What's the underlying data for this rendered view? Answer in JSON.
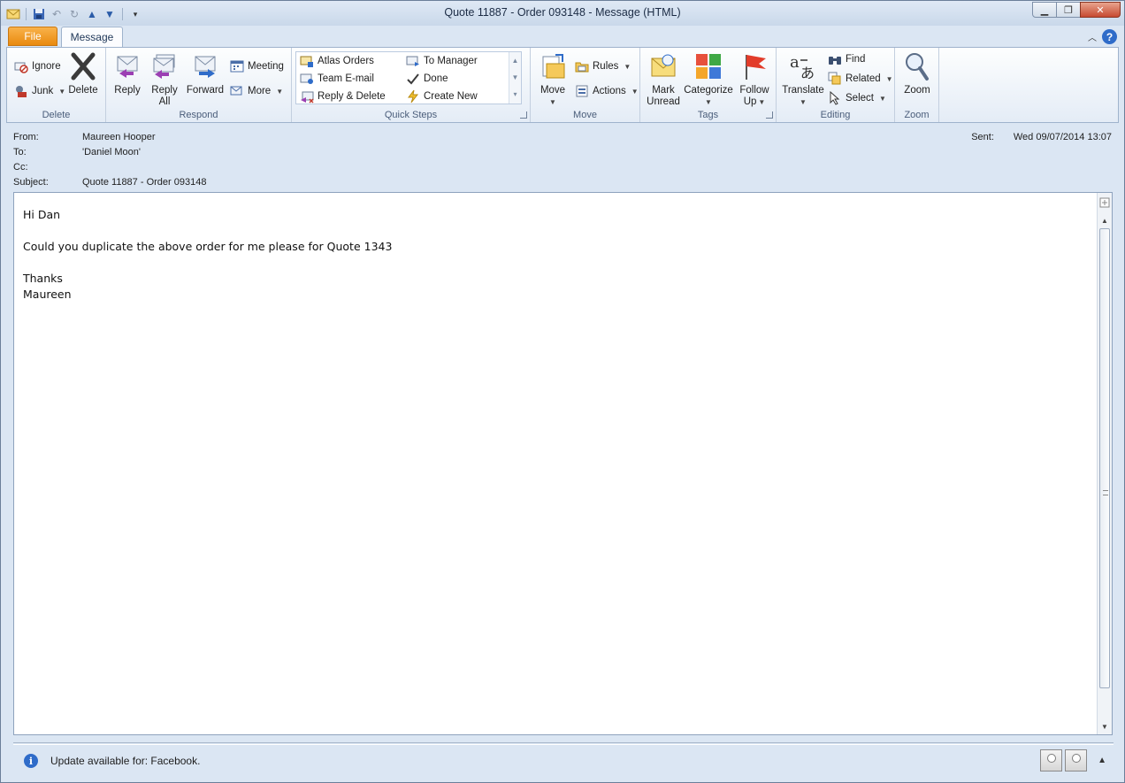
{
  "window": {
    "title": "Quote 11887 -  Order 093148  - Message (HTML)"
  },
  "tabs": {
    "file": "File",
    "message": "Message"
  },
  "ribbon": {
    "delete": {
      "label": "Delete",
      "ignore": "Ignore",
      "junk": "Junk",
      "delete": "Delete"
    },
    "respond": {
      "label": "Respond",
      "reply": "Reply",
      "reply_all_line1": "Reply",
      "reply_all_line2": "All",
      "forward": "Forward",
      "meeting": "Meeting",
      "more": "More"
    },
    "quick_steps": {
      "label": "Quick Steps",
      "items": [
        "Atlas Orders",
        "To Manager",
        "Team E-mail",
        "Done",
        "Reply & Delete",
        "Create New"
      ]
    },
    "move": {
      "label": "Move",
      "move": "Move",
      "rules": "Rules",
      "actions": "Actions"
    },
    "tags": {
      "label": "Tags",
      "mark_unread_line1": "Mark",
      "mark_unread_line2": "Unread",
      "categorize": "Categorize",
      "follow_up_line1": "Follow",
      "follow_up_line2": "Up"
    },
    "editing": {
      "label": "Editing",
      "translate": "Translate",
      "find": "Find",
      "related": "Related",
      "select": "Select"
    },
    "zoom": {
      "label": "Zoom",
      "zoom": "Zoom"
    }
  },
  "header": {
    "from_label": "From:",
    "from_value": "Maureen Hooper",
    "to_label": "To:",
    "to_value": "'Daniel Moon'",
    "cc_label": "Cc:",
    "cc_value": "",
    "subject_label": "Subject:",
    "subject_value": "Quote 11887 -  Order 093148",
    "sent_label": "Sent:",
    "sent_value": "Wed 09/07/2014 13:07"
  },
  "body": {
    "lines": [
      "Hi Dan",
      "",
      "Could you duplicate the above order for me please for Quote 1343",
      "",
      "Thanks",
      "Maureen"
    ]
  },
  "infobar": {
    "text": "Update available for: Facebook."
  },
  "colors": {
    "file_tab": "#e98a0f",
    "accent": "#2f6cc9",
    "close": "#c74a31"
  }
}
